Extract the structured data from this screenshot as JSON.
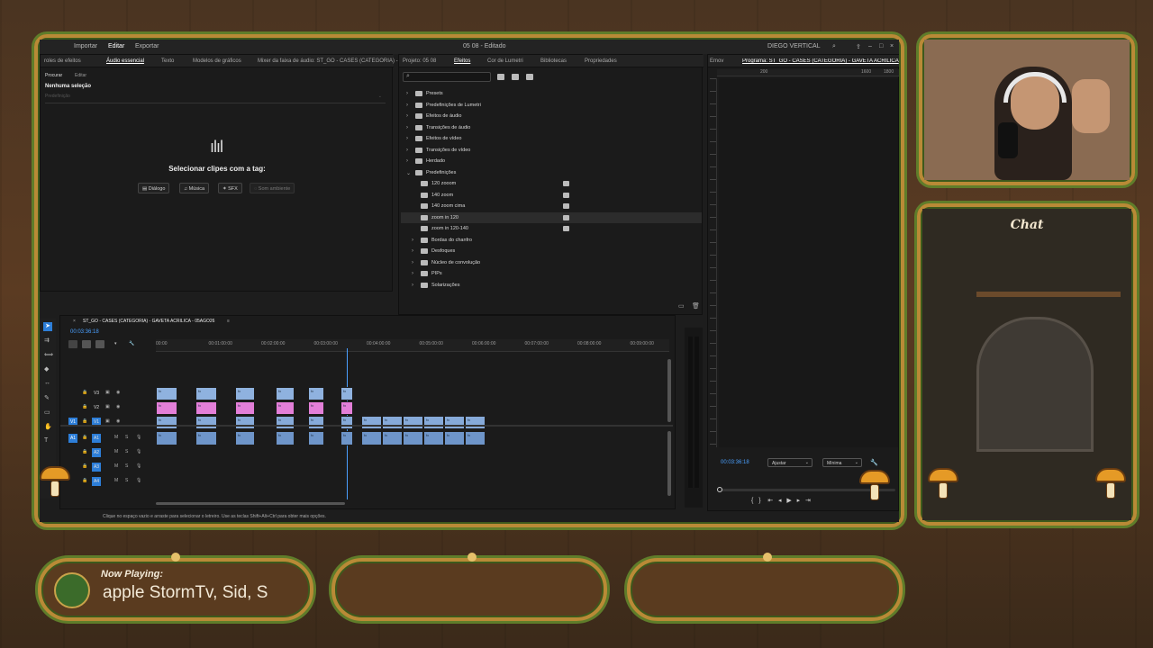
{
  "app": {
    "menu": {
      "import": "Importar",
      "edit": "Editar",
      "export": "Exportar",
      "title": "05 08 - Editado",
      "workspace": "DIEGO VERTICAL"
    },
    "left_tabs": [
      "roles de efeitos",
      "Áudio essencial",
      "Texto",
      "Modelos de gráficos",
      "Mixer da faixa de áudio: ST_GO - CASES (CATEGORIA) -"
    ],
    "essential": {
      "sub_tabs": [
        "Procurar",
        "Editar"
      ],
      "no_selection": "Nenhuma seleção",
      "preset_placeholder": "Predefinição",
      "tag_prompt": "Selecionar clipes com a tag:",
      "tags": [
        "Diálogo",
        "Música",
        "SFX",
        "Som ambiente"
      ]
    },
    "project_tabs": [
      "Projeto: 05 08",
      "Efeitos",
      "Cor de Lumetri",
      "Bibliotecas",
      "Propriedades"
    ],
    "effects_tree": [
      {
        "label": "Presets",
        "level": 0,
        "kind": "folder",
        "expanded": false
      },
      {
        "label": "Predefinições de Lumetri",
        "level": 0,
        "kind": "folder",
        "expanded": false
      },
      {
        "label": "Efeitos de áudio",
        "level": 0,
        "kind": "folder",
        "expanded": false
      },
      {
        "label": "Transições de áudio",
        "level": 0,
        "kind": "folder",
        "expanded": false
      },
      {
        "label": "Efeitos de vídeo",
        "level": 0,
        "kind": "folder",
        "expanded": false
      },
      {
        "label": "Transições de vídeo",
        "level": 0,
        "kind": "folder",
        "expanded": false
      },
      {
        "label": "Herdado",
        "level": 0,
        "kind": "folder",
        "expanded": false
      },
      {
        "label": "Predefinições",
        "level": 0,
        "kind": "folder",
        "expanded": true
      },
      {
        "label": "120 zooom",
        "level": 1,
        "kind": "preset"
      },
      {
        "label": "140 zoom",
        "level": 1,
        "kind": "preset"
      },
      {
        "label": "140 zoom cima",
        "level": 1,
        "kind": "preset"
      },
      {
        "label": "zoom in 120",
        "level": 1,
        "kind": "preset",
        "selected": true
      },
      {
        "label": "zoom in 120-140",
        "level": 1,
        "kind": "preset"
      },
      {
        "label": "Bordas do chanfro",
        "level": 1,
        "kind": "folder",
        "expanded": false
      },
      {
        "label": "Desfoques",
        "level": 1,
        "kind": "folder",
        "expanded": false
      },
      {
        "label": "Núcleo de convolução",
        "level": 1,
        "kind": "folder",
        "expanded": false
      },
      {
        "label": "PIPs",
        "level": 1,
        "kind": "folder",
        "expanded": false
      },
      {
        "label": "Solarizações",
        "level": 1,
        "kind": "folder",
        "expanded": false
      }
    ],
    "program": {
      "tab_left": "Emov",
      "title": "Programa: ST_GO - CASES (CATEGORIA) - GAVETA ACRILICA",
      "ruler_marks": [
        "200",
        "1600",
        "1800"
      ],
      "timecode": "00:03:36:18",
      "fit": "Ajustar",
      "quality": "Mínima"
    },
    "timeline": {
      "sequence_name": "ST_GO - CASES (CATEGORIA) - GAVETA ACRILICA - 05AGO26",
      "timecode": "00:03:36:18",
      "ruler": [
        "00:00",
        "00:01:00:00",
        "00:02:00:00",
        "00:03:00:00",
        "00:04:00:00",
        "00:05:00:00",
        "00:06:00:00",
        "00:07:00:00",
        "00:08:00:00",
        "00:09:00:00"
      ],
      "tracks": [
        {
          "name": "V3",
          "type": "video"
        },
        {
          "name": "V2",
          "type": "video"
        },
        {
          "name": "V1",
          "type": "video",
          "source": "V1"
        },
        {
          "name": "A1",
          "type": "audio",
          "source": "A1"
        },
        {
          "name": "A2",
          "type": "audio"
        },
        {
          "name": "A3",
          "type": "audio"
        },
        {
          "name": "A4",
          "type": "audio"
        }
      ],
      "clip_letter": "fx"
    },
    "status": "Clique no espaço vazio e arraste para selecionar o letreiro. Use as teclas Shift+Alt+Ctrl para obter mais opções."
  },
  "overlay": {
    "chat_title": "Chat",
    "now_playing_label": "Now Playing:",
    "now_playing_text": "apple StormTv, Sid, S"
  },
  "colors": {
    "accent_blue": "#2d7ed8",
    "clip_video": "#86aad9",
    "clip_pink": "#e37fd8",
    "frame_gold": "#b98a36"
  }
}
